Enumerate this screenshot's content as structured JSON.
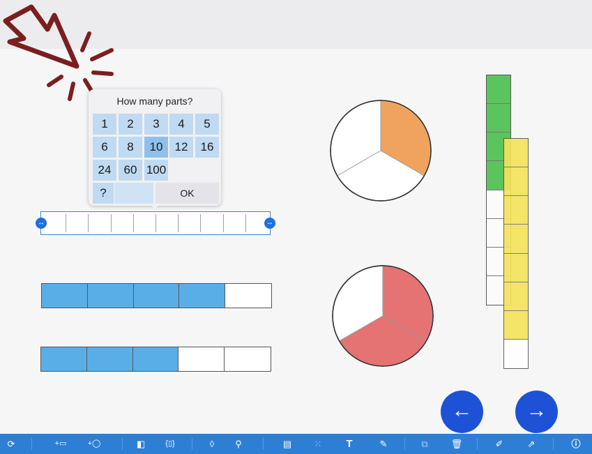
{
  "popup": {
    "title": "How many parts?",
    "options": [
      "1",
      "2",
      "3",
      "4",
      "5",
      "6",
      "8",
      "10",
      "12",
      "16",
      "24",
      "60",
      "100"
    ],
    "selected": "10",
    "custom_label": "?",
    "ok_label": "OK"
  },
  "colors": {
    "accent": "#2d7fd6",
    "bar_fill": "#5aaee8",
    "pie_orange": "#f0a35e",
    "pie_red": "#e57373",
    "stack_green": "#5cc45c",
    "stack_yellow": "#f4e35c",
    "nav_button": "#1d52d6"
  },
  "strip": {
    "parts": 10
  },
  "bars": [
    {
      "parts": 5,
      "filled": 4
    },
    {
      "parts": 5,
      "filled": 3
    }
  ],
  "pies": [
    {
      "parts": 3,
      "filled": 1,
      "color": "orange"
    },
    {
      "parts": 3,
      "filled": 2,
      "color": "red"
    }
  ],
  "stacks": [
    {
      "parts": 8,
      "filled": 4,
      "color": "green"
    },
    {
      "parts": 8,
      "filled": 7,
      "color": "yellow"
    }
  ],
  "nav": {
    "back_icon": "arrow-left-icon",
    "forward_icon": "arrow-right-icon"
  },
  "toolbar": {
    "icons": [
      "refresh-icon",
      "add-bar-icon",
      "add-circle-icon",
      "fraction-icon",
      "brackets-icon",
      "fill-icon",
      "zoom-icon",
      "table-icon",
      "grid-icon",
      "text-icon",
      "pen-icon",
      "duplicate-icon",
      "trash-icon",
      "settings-icon",
      "share-icon",
      "info-icon"
    ]
  }
}
